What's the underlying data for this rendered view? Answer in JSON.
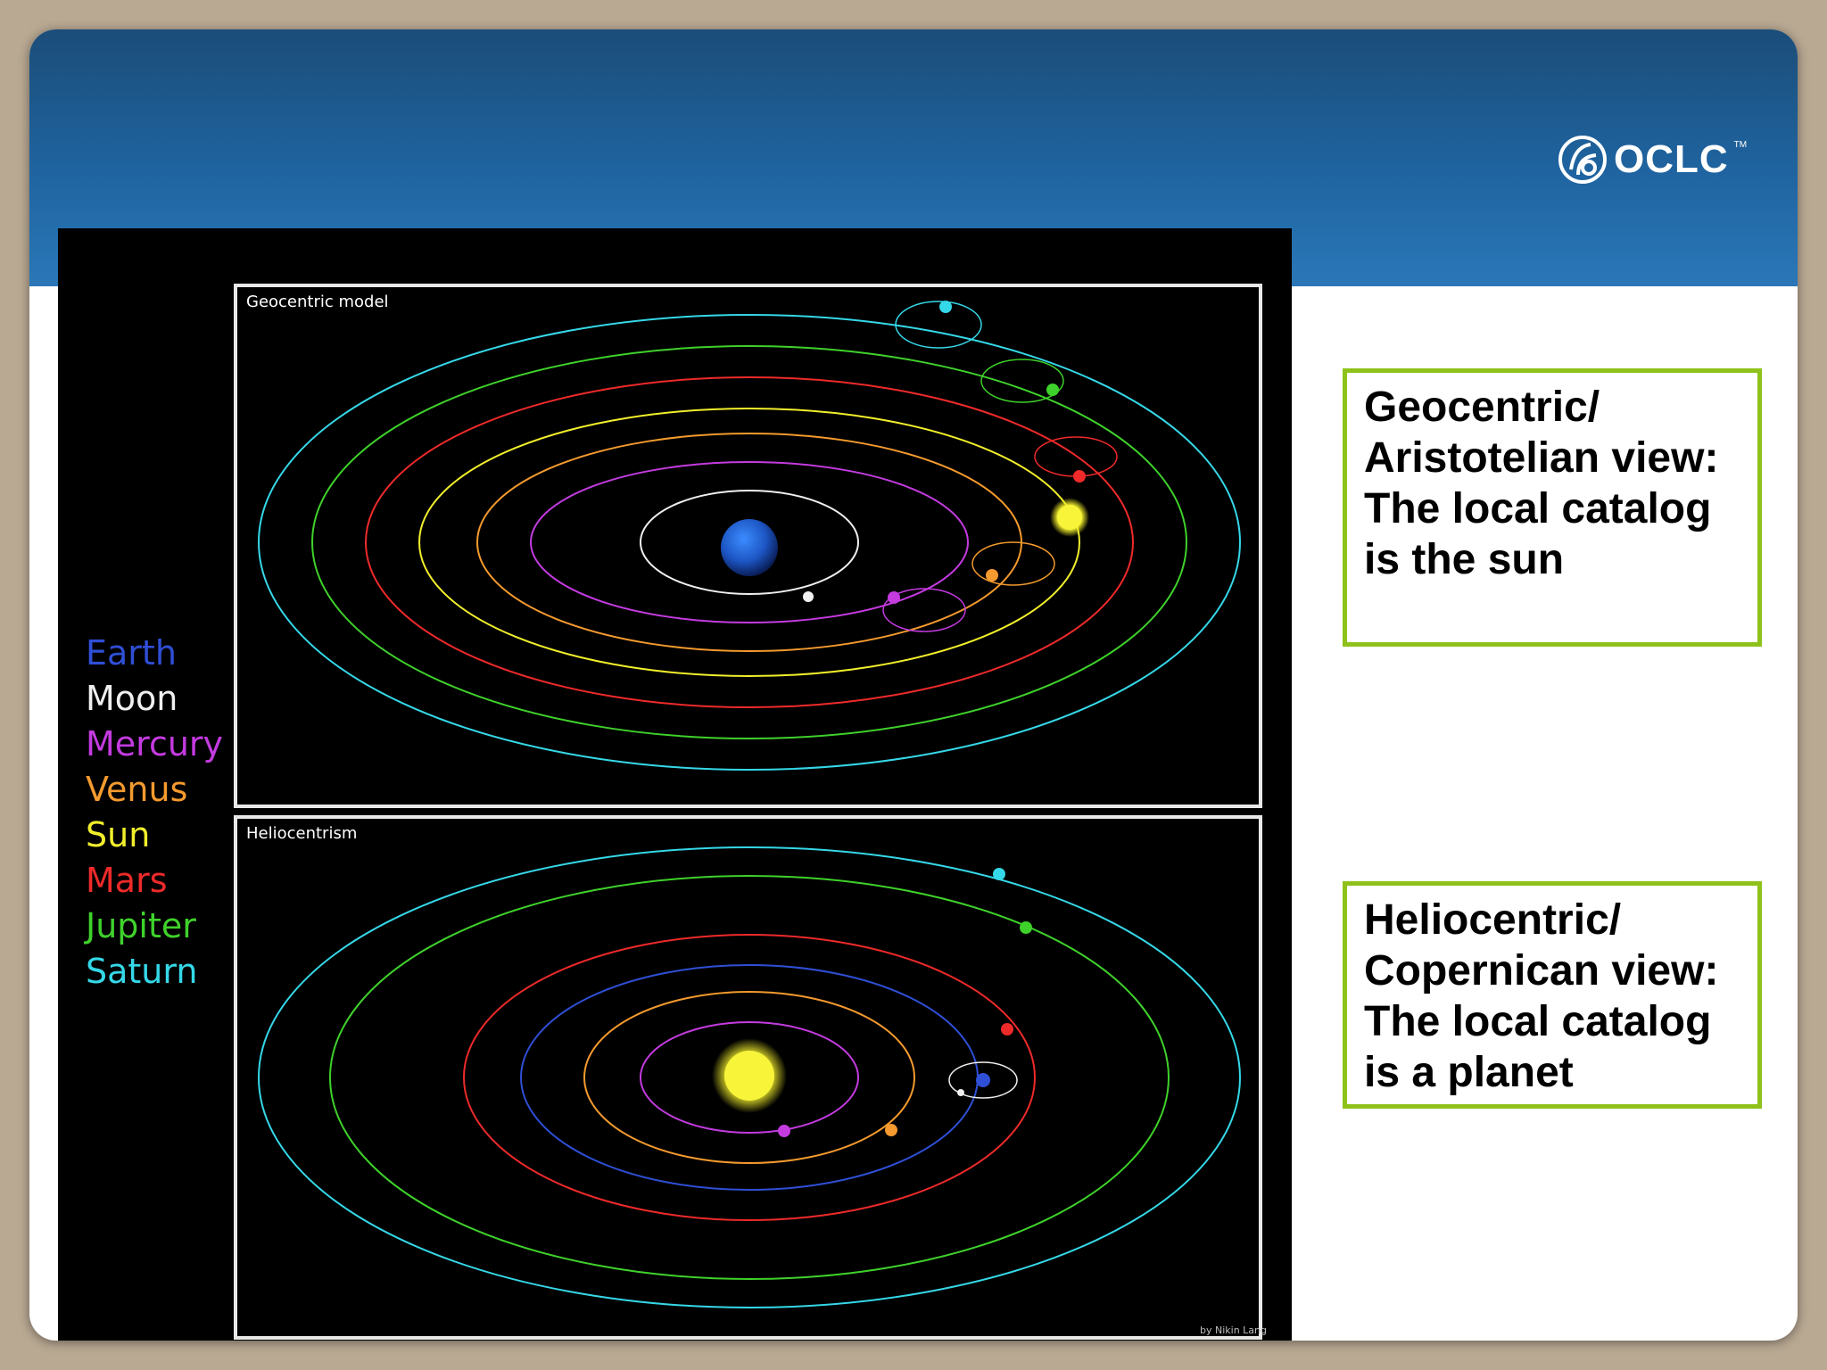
{
  "logo": {
    "text": "OCLC",
    "tm": "TM",
    "icon": "oclc-logo-icon"
  },
  "figure": {
    "legend": [
      {
        "label": "Earth",
        "color": "#2f4fd6"
      },
      {
        "label": "Moon",
        "color": "#f0f0f0"
      },
      {
        "label": "Mercury",
        "color": "#c43be0"
      },
      {
        "label": "Venus",
        "color": "#f49a2e"
      },
      {
        "label": "Sun",
        "color": "#f2ef2c"
      },
      {
        "label": "Mars",
        "color": "#ee2a2a"
      },
      {
        "label": "Jupiter",
        "color": "#3fd12b"
      },
      {
        "label": "Saturn",
        "color": "#35d8e8"
      }
    ],
    "geocentric_title": "Geocentric model",
    "heliocentric_title": "Heliocentrism",
    "credit": "by Nikin Lang"
  },
  "callouts": [
    {
      "text": "Geocentric/ Aristotelian view: The local catalog is the sun"
    },
    {
      "text": "Heliocentric/ Copernican view: The local catalog is a planet"
    }
  ]
}
